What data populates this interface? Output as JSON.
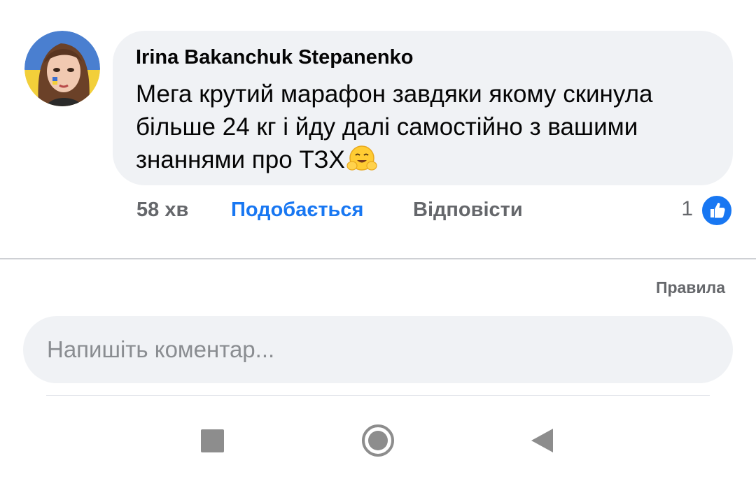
{
  "comment": {
    "author": "Irina Bakanchuk Stepanenko",
    "text": "Мега крутий марафон завдяки якому скинула більше 24 кг і йду далі самостійно з вашими знаннями про ТЗХ",
    "emoji": "hugging-face-emoji",
    "time": "58 хв",
    "like_label": "Подобається",
    "reply_label": "Відповісти",
    "like_count": "1",
    "reaction_icon": "thumbs-up-icon"
  },
  "footer": {
    "rules_label": "Правила",
    "comment_placeholder": "Напишіть коментар..."
  },
  "nav": {
    "recents_icon": "square-icon",
    "home_icon": "home-circle-icon",
    "back_icon": "back-triangle-icon"
  },
  "colors": {
    "accent": "#1877f2",
    "bubble": "#f0f2f5",
    "secondary_text": "#65676b"
  }
}
